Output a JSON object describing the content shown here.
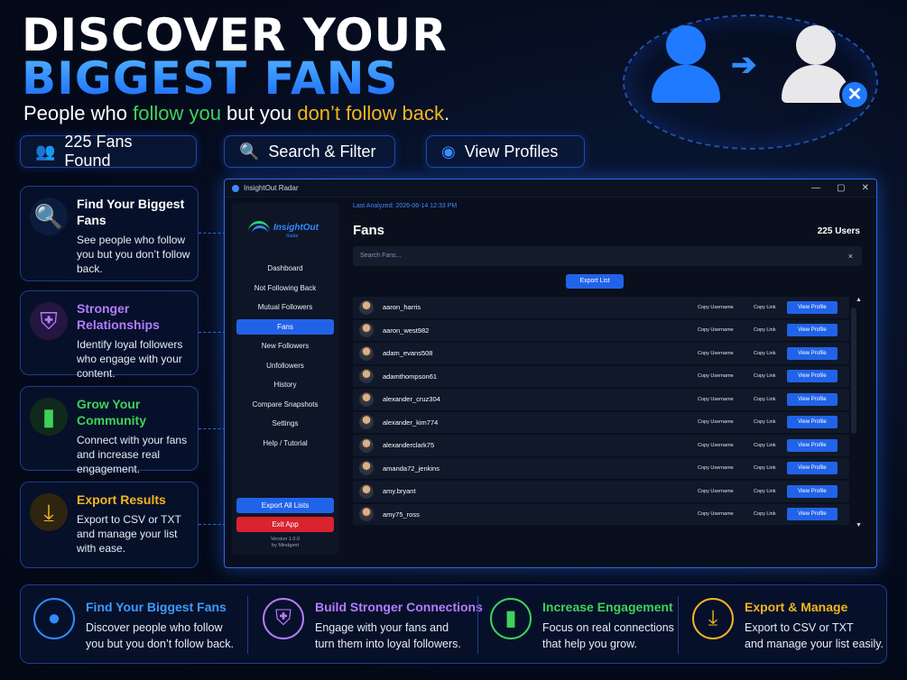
{
  "headline": {
    "line1": "DISCOVER YOUR",
    "line2": "BIGGEST FANS",
    "sub_a": "People who ",
    "sub_b": "follow you",
    "sub_c": " but you ",
    "sub_d": "don’t follow back",
    "sub_e": "."
  },
  "pills": [
    {
      "label": "225 Fans Found",
      "icon": "users-icon"
    },
    {
      "label": "Search & Filter",
      "icon": "search-icon"
    },
    {
      "label": "View Profiles",
      "icon": "profile-icon"
    }
  ],
  "features": [
    {
      "title": "Find Your Biggest Fans",
      "desc": "See people who follow you but you don’t follow back.",
      "color": "#ffffff",
      "icon": "search-icon"
    },
    {
      "title": "Stronger Relationships",
      "desc": "Identify loyal followers who engage with your content.",
      "color": "#b47cff",
      "icon": "shield-handshake-icon"
    },
    {
      "title": "Grow Your Community",
      "desc": "Connect with your fans and increase real engagement.",
      "color": "#3fd25a",
      "icon": "bar-chart-icon"
    },
    {
      "title": "Export Results",
      "desc": "Export to CSV or TXT and manage your list with ease.",
      "color": "#f2b51e",
      "icon": "download-icon"
    }
  ],
  "window": {
    "title": "InsightOut Radar",
    "logo_text": "InsightOut",
    "logo_sub": "Radar",
    "nav": [
      "Dashboard",
      "Not Following Back",
      "Mutual Followers",
      "Fans",
      "New Followers",
      "Unfollowers",
      "History",
      "Compare Snapshots",
      "Settings",
      "Help / Tutorial"
    ],
    "active_nav": "Fans",
    "export_all": "Export All Lists",
    "exit": "Exit App",
    "version": "Version 1.0.0",
    "by": "by Mindgent",
    "last_analyzed": "Last Analyzed: 2026-06-14 12:33 PM",
    "page_title": "Fans",
    "user_count": "225 Users",
    "search_placeholder": "Search Fans...",
    "clear": "×",
    "export_list": "Export List",
    "copy_username": "Copy Username",
    "copy_link": "Copy Link",
    "view_profile": "View Profile",
    "users": [
      "aaron_harris",
      "aaron_west982",
      "adam_evans508",
      "adamthompson61",
      "alexander_cruz304",
      "alexander_kim774",
      "alexanderclark75",
      "amanda72_jenkins",
      "amy.bryant",
      "amy75_ross"
    ]
  },
  "bottom": [
    {
      "title": "Find Your Biggest Fans",
      "line1": "Discover people who follow",
      "line2": "you but you don’t follow back.",
      "color": "#3d9bff",
      "icon": "user-icon"
    },
    {
      "title": "Build Stronger Connections",
      "line1": "Engage with your fans and",
      "line2": "turn them into loyal followers.",
      "color": "#b47cff",
      "icon": "shield-handshake-icon"
    },
    {
      "title": "Increase Engagement",
      "line1": "Focus on real connections",
      "line2": "that help you grow.",
      "color": "#3fd25a",
      "icon": "bar-chart-icon"
    },
    {
      "title": "Export & Manage",
      "line1": "Export to CSV or TXT",
      "line2": "and manage your list easily.",
      "color": "#f2b51e",
      "icon": "download-icon"
    }
  ]
}
